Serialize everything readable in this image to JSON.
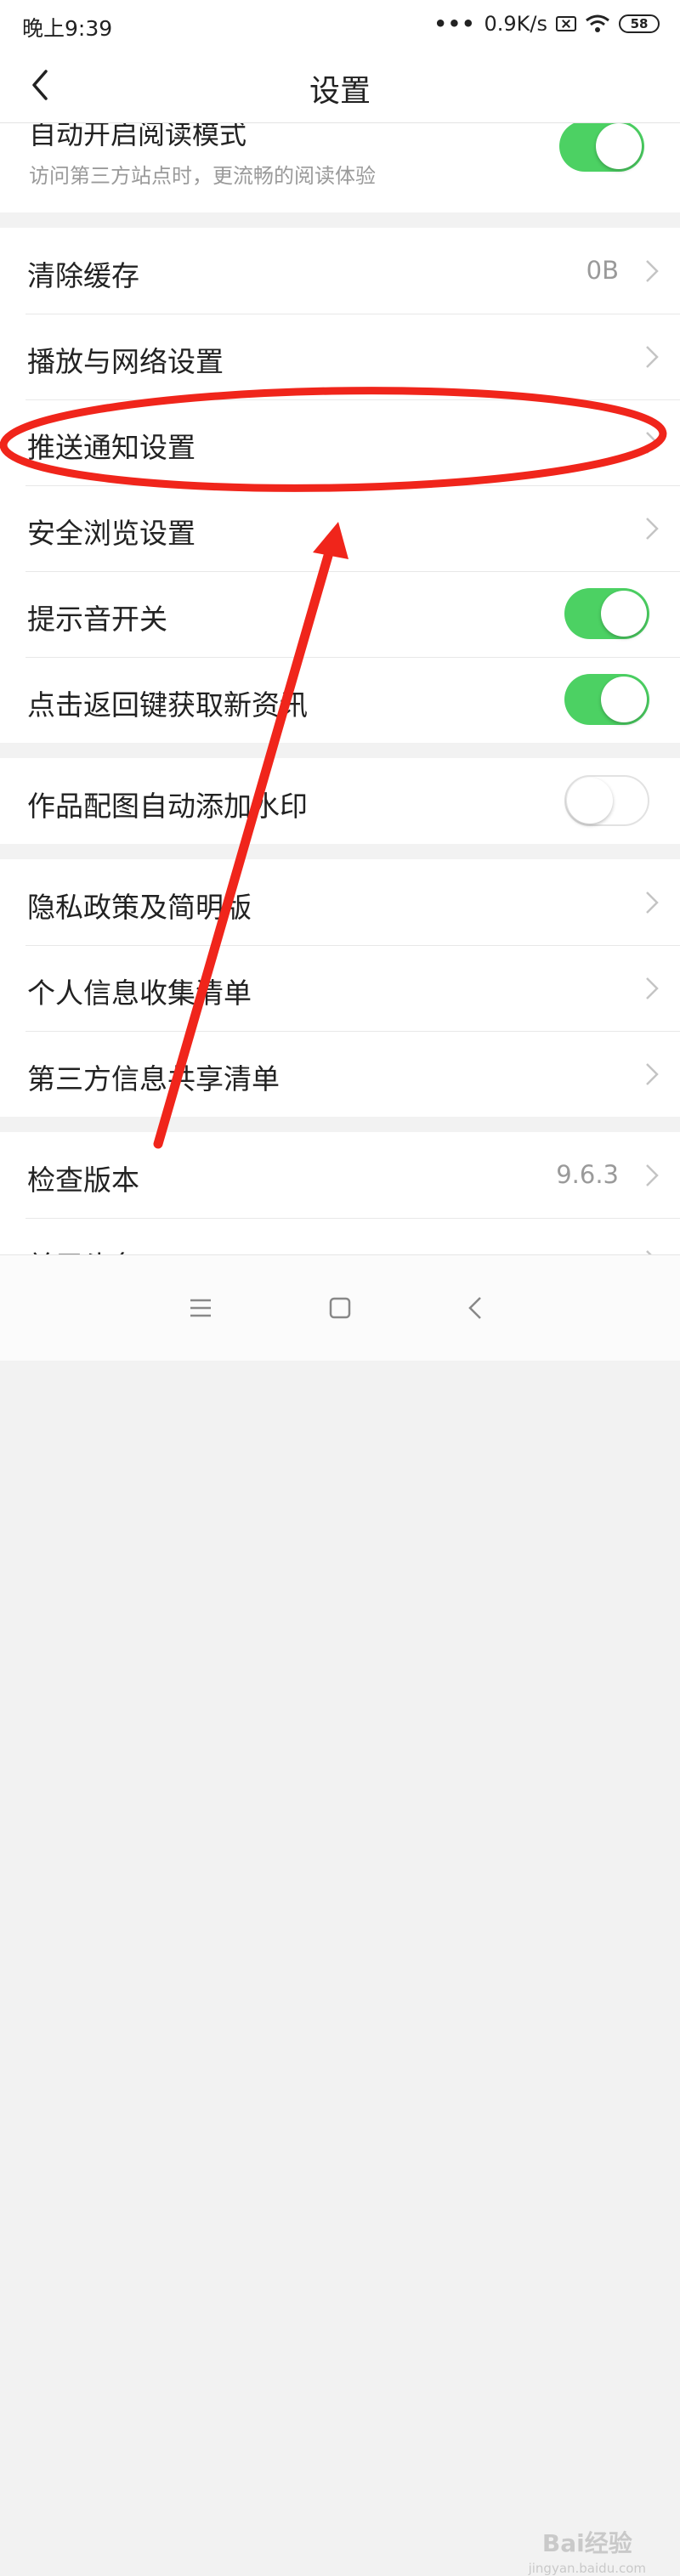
{
  "status_bar": {
    "time": "晚上9:39",
    "network_speed": "0.9K/s",
    "battery": "58",
    "icons": [
      "more-dots-icon",
      "sim-disabled-icon",
      "wifi-icon",
      "battery-icon"
    ]
  },
  "header": {
    "title": "设置",
    "back_icon": "chevron-left-icon"
  },
  "partial_row": {
    "title": "自动开启阅读模式",
    "subtitle": "访问第三方站点时，更流畅的阅读体验",
    "toggle_on": true
  },
  "sections": {
    "general": [
      {
        "label": "清除缓存",
        "value": "0B"
      },
      {
        "label": "播放与网络设置"
      },
      {
        "label": "推送通知设置"
      },
      {
        "label": "安全浏览设置"
      },
      {
        "label": "提示音开关",
        "toggle_on": true
      },
      {
        "label": "点击返回键获取新资讯",
        "toggle_on": true
      }
    ],
    "watermark_setting": [
      {
        "label": "作品配图自动添加水印",
        "toggle_on": false
      }
    ],
    "privacy": [
      {
        "label": "隐私政策及简明版"
      },
      {
        "label": "个人信息收集清单"
      },
      {
        "label": "第三方信息共享清单"
      }
    ],
    "about": [
      {
        "label": "检查版本",
        "value": "9.6.3"
      },
      {
        "label": "关于头条"
      }
    ]
  },
  "nav_bar": {
    "icons": [
      "menu-icon",
      "home-square-icon",
      "back-triangle-icon"
    ]
  },
  "watermark": {
    "text": "Bai经验",
    "sub": "jingyan.baidu.com"
  },
  "colors": {
    "toggle_on": "#4cd163",
    "annotation_red": "#f0251b",
    "subtext": "#9a9a9a"
  }
}
